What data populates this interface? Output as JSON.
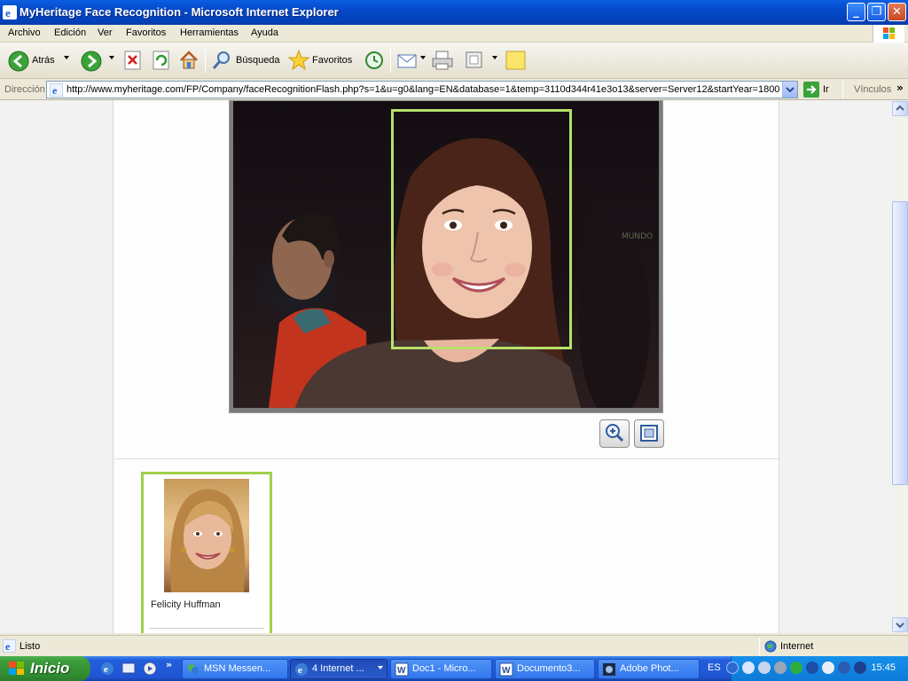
{
  "window": {
    "title": "MyHeritage Face Recognition - Microsoft Internet Explorer"
  },
  "menu": {
    "items": [
      "Archivo",
      "Edición",
      "Ver",
      "Favoritos",
      "Herramientas",
      "Ayuda"
    ]
  },
  "toolbar": {
    "back_label": "Atrás",
    "search_label": "Búsqueda",
    "favorites_label": "Favoritos"
  },
  "address": {
    "label": "Dirección",
    "url": "http://www.myheritage.com/FP/Company/faceRecognitionFlash.php?s=1&u=g0&lang=EN&database=1&temp=3110d344r41e3o13&server=Server12&startYear=1800",
    "go_label": "Ir",
    "links_label": "Vínculos"
  },
  "content": {
    "match": {
      "name": "Felicity Huffman"
    },
    "sign_text": "MUNDO"
  },
  "status": {
    "text": "Listo",
    "zone": "Internet"
  },
  "taskbar": {
    "start_label": "Inicio",
    "tasks": [
      {
        "label": "MSN Messen..."
      },
      {
        "label": "4 Internet ..."
      },
      {
        "label": "Doc1 - Micro..."
      },
      {
        "label": "Documento3..."
      },
      {
        "label": "Adobe Phot..."
      }
    ],
    "lang": "ES",
    "clock": "15:45"
  },
  "colors": {
    "face_box": "#b7e06b",
    "match_border": "#9ed04a",
    "title_bar": "#0549c9"
  }
}
